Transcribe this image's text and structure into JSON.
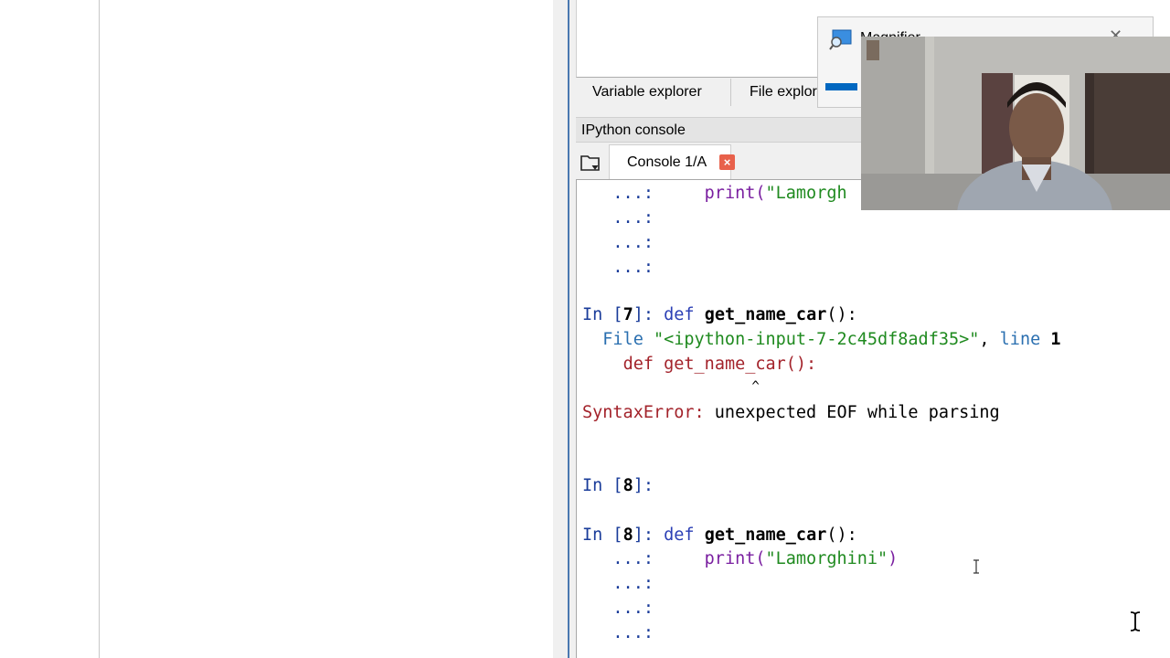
{
  "right_pane": {
    "tabs": [
      {
        "label": "Variable explorer"
      },
      {
        "label": "File explor"
      }
    ],
    "console_panel_title": "IPython console",
    "console_tab": {
      "label": "Console 1/A",
      "close_glyph": "×"
    }
  },
  "console": {
    "top_line": {
      "prompt": "   ...: ",
      "indent": "    ",
      "code": "print(",
      "str": "\"Lamorgh"
    },
    "cont": "   ...:",
    "in7": {
      "prompt": "In [",
      "num": "7",
      "close": "]: ",
      "kw": "def ",
      "fn": "get_name_car",
      "rest": "():"
    },
    "tb_file": {
      "pre": "  File ",
      "path": "\"<ipython-input-7-2c45df8adf35>\"",
      "sep": ", ",
      "line_kw": "line ",
      "line_num": "1"
    },
    "tb_code": {
      "indent": "    ",
      "kw": "def ",
      "rest": "get_name_car():"
    },
    "tb_caret": "                      ^",
    "error": {
      "type": "SyntaxError:",
      "msg": " unexpected EOF while parsing"
    },
    "in8_empty": {
      "prompt": "In [",
      "num": "8",
      "close": "]:"
    },
    "in8": {
      "prompt": "In [",
      "num": "8",
      "close": "]: ",
      "kw": "def ",
      "fn": "get_name_car",
      "rest": "():"
    },
    "in8_body": {
      "prompt": "   ...: ",
      "indent": "    ",
      "code": "print(",
      "str": "\"Lamorghini\"",
      "end": ")"
    }
  },
  "magnifier": {
    "title": "Magnifier",
    "close_glyph": "✕"
  },
  "colors": {
    "accent": "#0067c0",
    "pane_border": "#4a78b0",
    "close_tab": "#e8614b"
  }
}
